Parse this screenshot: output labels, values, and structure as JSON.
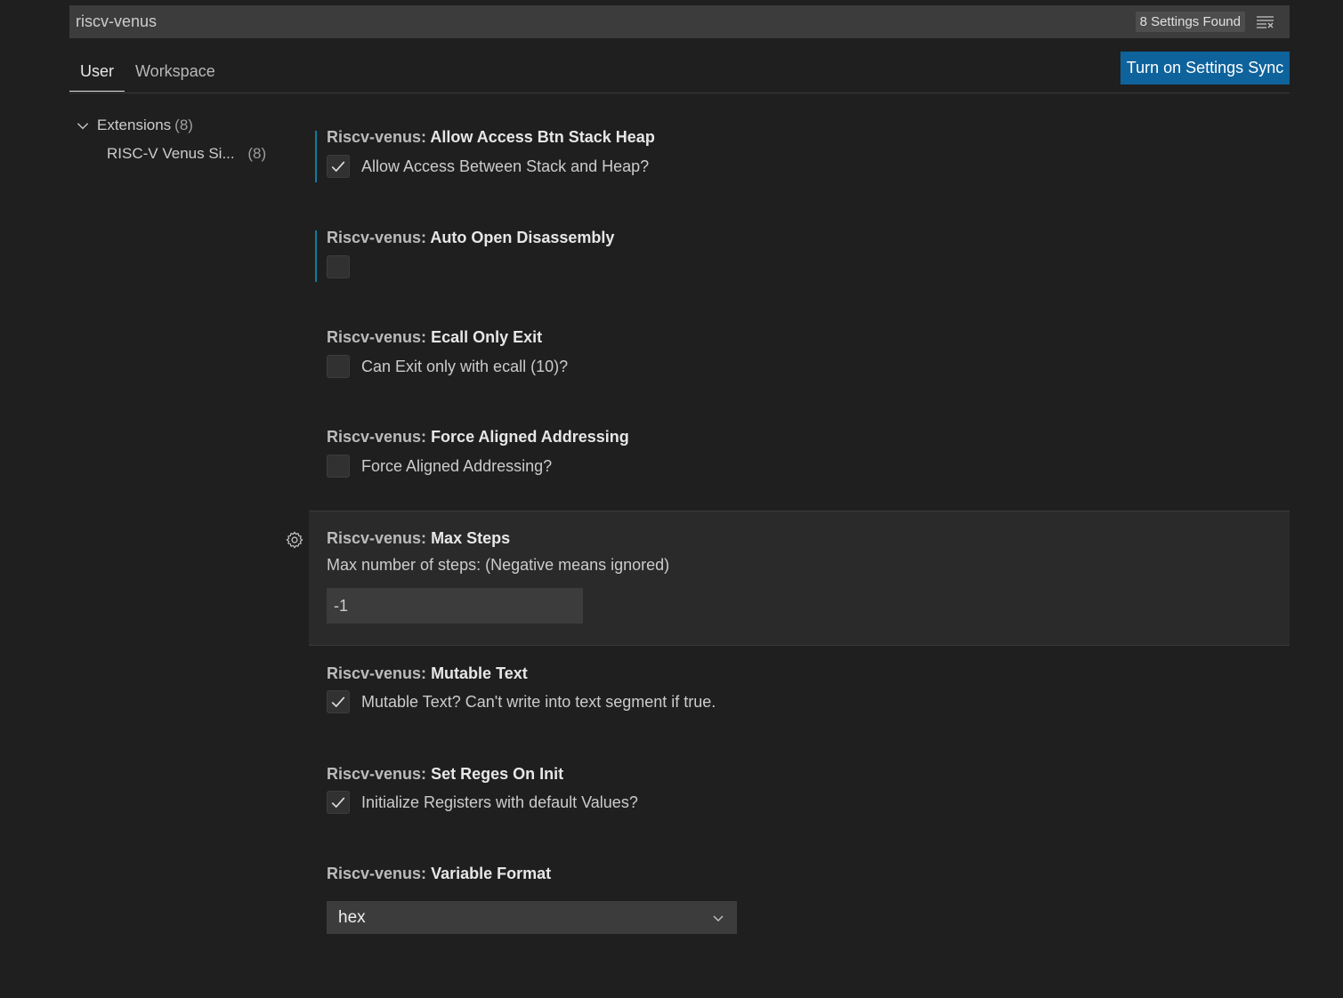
{
  "search": {
    "value": "riscv-venus",
    "results_count": "8 Settings Found",
    "clear_icon": "clear-filter-icon"
  },
  "tabs": [
    {
      "label": "User",
      "active": true
    },
    {
      "label": "Workspace",
      "active": false
    }
  ],
  "sync_button": "Turn on Settings Sync",
  "toc": {
    "group_label": "Extensions",
    "group_count": "(8)",
    "item_label": "RISC-V Venus Si...",
    "item_count": "(8)"
  },
  "settings": [
    {
      "category": "Riscv-venus:",
      "name": "Allow Access Btn Stack Heap",
      "type": "checkbox",
      "checked": true,
      "description": "Allow Access Between Stack and Heap?",
      "modified": true
    },
    {
      "category": "Riscv-venus:",
      "name": "Auto Open Disassembly",
      "type": "checkbox",
      "checked": false,
      "description": "",
      "modified": true
    },
    {
      "category": "Riscv-venus:",
      "name": "Ecall Only Exit",
      "type": "checkbox",
      "checked": false,
      "description": "Can Exit only with ecall (10)?",
      "modified": false
    },
    {
      "category": "Riscv-venus:",
      "name": "Force Aligned Addressing",
      "type": "checkbox",
      "checked": false,
      "description": "Force Aligned Addressing?",
      "modified": false
    },
    {
      "category": "Riscv-venus:",
      "name": "Max Steps",
      "type": "number",
      "description": "Max number of steps: (Negative means ignored)",
      "value": "-1",
      "modified": false
    },
    {
      "category": "Riscv-venus:",
      "name": "Mutable Text",
      "type": "checkbox",
      "checked": true,
      "description": "Mutable Text? Can't write into text segment if true.",
      "modified": false
    },
    {
      "category": "Riscv-venus:",
      "name": "Set Reges On Init",
      "type": "checkbox",
      "checked": true,
      "description": "Initialize Registers with default Values?",
      "modified": false
    },
    {
      "category": "Riscv-venus:",
      "name": "Variable Format",
      "type": "select",
      "value": "hex",
      "modified": false
    }
  ],
  "colors": {
    "background": "#1f1f1f",
    "accent": "#0e639c",
    "modified_indicator": "#0c7d9d"
  }
}
